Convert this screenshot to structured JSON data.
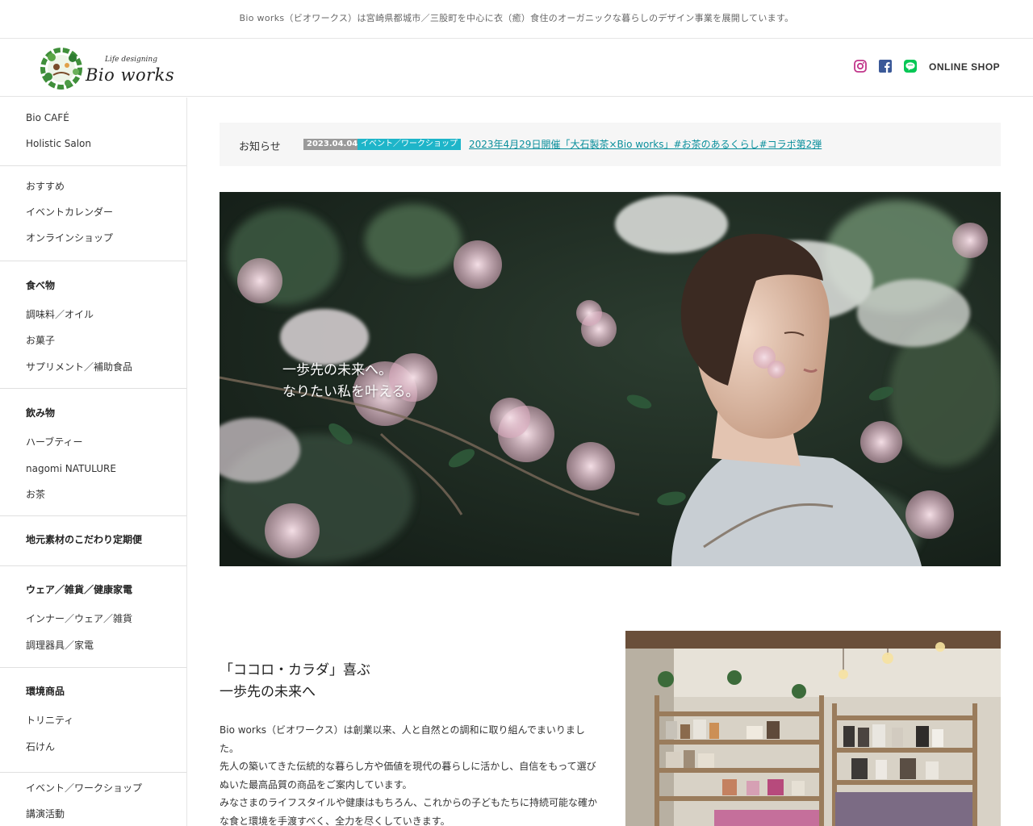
{
  "topbar": {
    "text": "Bio works（ビオワークス）は宮崎県都城市／三股町を中心に衣（癒）食住のオーガニックな暮らしのデザイン事業を展開しています。"
  },
  "header": {
    "logo_sub": "Life designing",
    "logo_text": "Bio works",
    "social": [
      "instagram-icon",
      "facebook-icon",
      "line-icon"
    ],
    "shop_label": "ONLINE SHOP"
  },
  "sidebar": {
    "group1": [
      "Bio CAFÉ",
      "Holistic Salon"
    ],
    "group2": [
      "おすすめ",
      "イベントカレンダー",
      "オンラインショップ"
    ],
    "food": {
      "heading": "食べ物",
      "items": [
        "調味料／オイル",
        "お菓子",
        "サプリメント／補助食品"
      ]
    },
    "drink": {
      "heading": "飲み物",
      "items": [
        "ハーブティー",
        "nagomi NATULURE",
        "お茶"
      ]
    },
    "regular": {
      "heading": "地元素材のこだわり定期便"
    },
    "wear": {
      "heading": "ウェア／雑貨／健康家電",
      "items": [
        "インナー／ウェア／雑貨",
        "調理器具／家電"
      ]
    },
    "env": {
      "heading": "環境商品",
      "items": [
        "トリニティ",
        "石けん"
      ]
    },
    "events": [
      "イベント／ワークショップ",
      "講演活動"
    ]
  },
  "news": {
    "label": "お知らせ",
    "date": "2023.04.04",
    "category": "イベント／ワークショップ",
    "title": "2023年4月29日開催「大石製茶×Bio works」#お茶のあるくらし#コラボ第2弾"
  },
  "hero": {
    "line1": "一歩先の未来へ。",
    "line2": "なりたい私を叶える。"
  },
  "intro": {
    "title_line1": "「ココロ・カラダ」喜ぶ",
    "title_line2": "一歩先の未来へ",
    "p1": "Bio works（ビオワークス）は創業以来、人と自然との調和に取り組んでまいりました。",
    "p2": "先人の築いてきた伝統的な暮らし方や価値を現代の暮らしに活かし、自信をもって選びぬいた最高品質の商品をご案内しています。",
    "p3": "みなさまのライフスタイルや健康はもちろん、これからの子どもたちに持続可能な確かな食と環境を手渡すべく、全力を尽くしていきます。"
  },
  "colors": {
    "accent": "#1eb5c9",
    "link": "#0a8f9c",
    "date_badge": "#9a9a9a",
    "news_bg": "#f6f6f6"
  }
}
